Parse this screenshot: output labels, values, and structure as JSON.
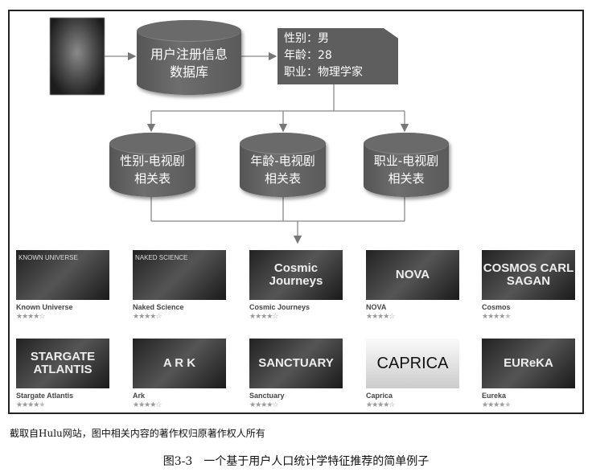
{
  "diagram": {
    "user_db": [
      "用户注册信息",
      "数据库"
    ],
    "profile": [
      "性别：男",
      "年龄：28",
      "职业：物理学家"
    ],
    "tables": [
      [
        "性别-电视剧",
        "相关表"
      ],
      [
        "年龄-电视剧",
        "相关表"
      ],
      [
        "职业-电视剧",
        "相关表"
      ]
    ]
  },
  "shows": [
    {
      "title": "Known Universe",
      "logo": "",
      "tag": "KNOWN UNIVERSE",
      "rating": 4
    },
    {
      "title": "Naked Science",
      "logo": "",
      "tag": "NAKED SCIENCE",
      "rating": 4
    },
    {
      "title": "Cosmic Journeys",
      "logo": "Cosmic Journeys",
      "tag": "",
      "rating": 4
    },
    {
      "title": "NOVA",
      "logo": "NOVA",
      "tag": "",
      "rating": 4
    },
    {
      "title": "Cosmos",
      "logo": "COSMOS CARL SAGAN",
      "tag": "",
      "rating": 4.5
    },
    {
      "title": "Stargate Atlantis",
      "logo": "STARGATE ATLANTIS",
      "tag": "",
      "rating": 4.5
    },
    {
      "title": "Ark",
      "logo": "A R K",
      "tag": "",
      "rating": 4
    },
    {
      "title": "Sanctuary",
      "logo": "SANCTUARY",
      "tag": "",
      "rating": 4
    },
    {
      "title": "Caprica",
      "logo": "CAPRICA",
      "tag": "",
      "rating": 4
    },
    {
      "title": "Eureka",
      "logo": "EUReKA",
      "tag": "",
      "rating": 4.5
    }
  ],
  "source_note": "截取自Hulu网站，图中相关内容的著作权归原著作权人所有",
  "figure_caption": "图3-3　一个基于用户人口统计学特征推荐的简单例子"
}
